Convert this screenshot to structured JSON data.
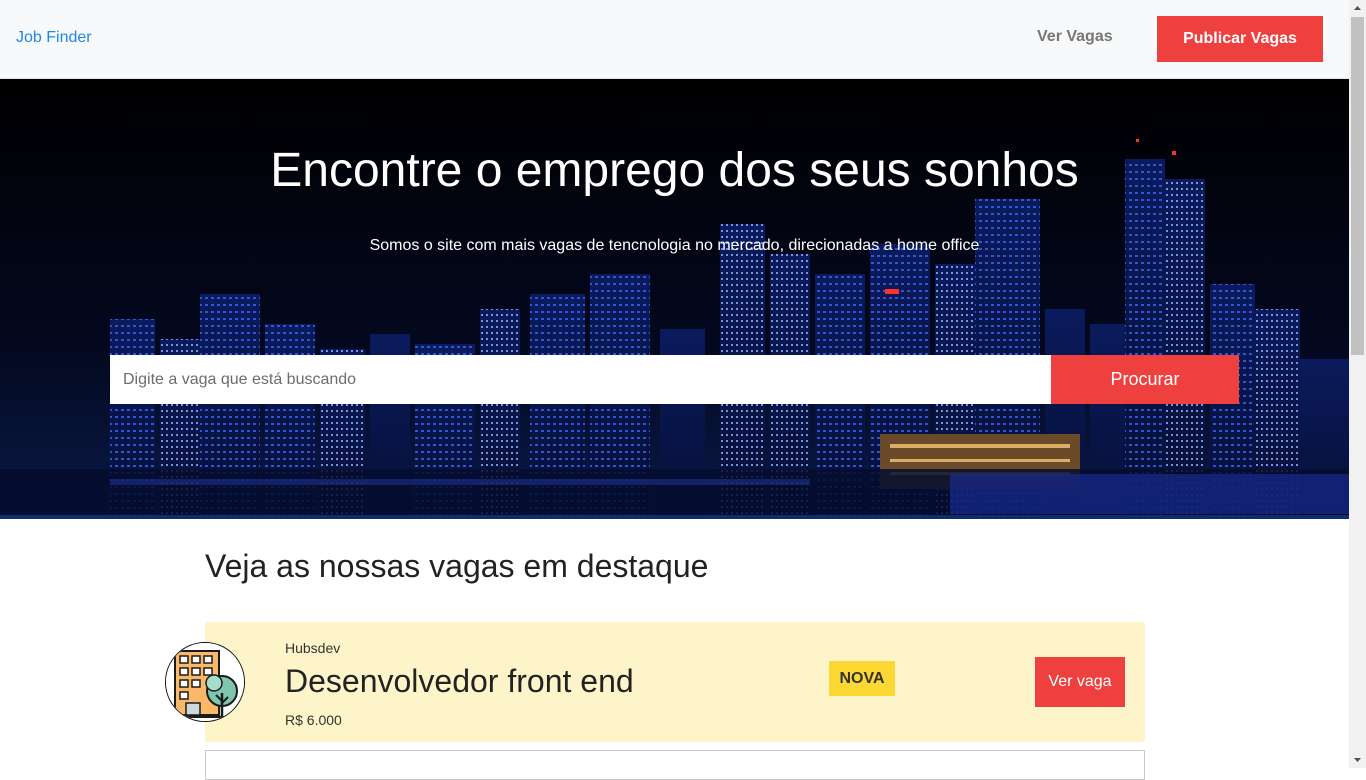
{
  "nav": {
    "brand": "Job Finder",
    "view_jobs": "Ver Vagas",
    "publish_jobs": "Publicar Vagas"
  },
  "hero": {
    "title": "Encontre o emprego dos seus sonhos",
    "subtitle": "Somos o site com mais vagas de tencnologia no mercado, direcionadas a home office",
    "search_placeholder": "Digite a vaga que está buscando",
    "search_button": "Procurar"
  },
  "featured": {
    "heading": "Veja as nossas vagas em destaque",
    "jobs": [
      {
        "company": "Hubsdev",
        "title": "Desenvolvedor front end",
        "salary": "R$ 6.000",
        "badge": "NOVA",
        "action": "Ver vaga",
        "logo_icon": "building-tree-icon"
      }
    ]
  },
  "colors": {
    "accent": "#ef4040",
    "brand_link": "#1e88e5",
    "card_bg": "#fdf5c9",
    "badge": "#fdd835"
  }
}
